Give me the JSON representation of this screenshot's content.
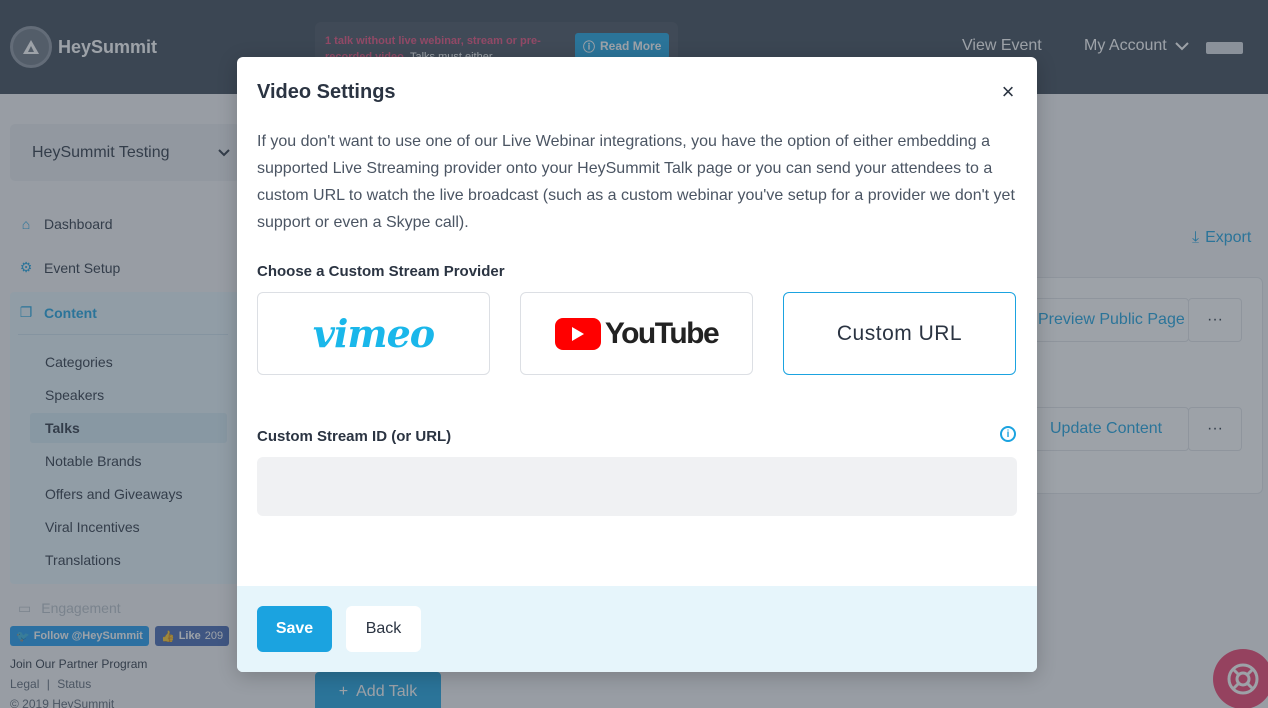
{
  "app": {
    "brand": "HeySummit",
    "notice": {
      "text_highlight": "1 talk without live webinar, stream or pre-recorded video.",
      "text_rest": "Talks must either",
      "button": "Read More"
    },
    "nav_links": {
      "view_event": "View Event",
      "my_account": "My Account"
    }
  },
  "sidebar": {
    "event_name": "HeySummit Testing",
    "items": [
      {
        "label": "Dashboard",
        "icon": "home-icon"
      },
      {
        "label": "Event Setup",
        "icon": "gears-icon"
      },
      {
        "label": "Content",
        "icon": "copy-icon"
      }
    ],
    "content_sub": [
      "Categories",
      "Speakers",
      "Talks",
      "Notable Brands",
      "Offers and Giveaways",
      "Viral Incentives",
      "Translations"
    ],
    "active_sub": "Talks",
    "faded_item": "Engagement",
    "twitter": "Follow @HeySummit",
    "fb_like": "Like",
    "fb_count": "209",
    "partner": "Join Our Partner Program",
    "legal": "Legal",
    "status": "Status",
    "copyright": "© 2019 HeySummit"
  },
  "main": {
    "export": "Export",
    "preview_public_page": "Preview Public Page",
    "update_content": "Update Content",
    "more": "···",
    "add_talk": "Add Talk"
  },
  "modal": {
    "title": "Video Settings",
    "close": "×",
    "description": "If you don't want to use one of our Live Webinar integrations, you have the option of either embedding a supported Live Streaming provider onto your HeySummit Talk page or you can send your attendees to a custom URL to watch the live broadcast (such as a custom webinar you've setup for a provider we don't yet support or even a Skype call).",
    "provider_label": "Choose a Custom Stream Provider",
    "providers": [
      {
        "name": "vimeo",
        "selected": false
      },
      {
        "name": "YouTube",
        "selected": false
      },
      {
        "name": "Custom URL",
        "selected": true
      }
    ],
    "stream_label": "Custom Stream ID (or URL)",
    "stream_value": "",
    "save": "Save",
    "back": "Back"
  },
  "colors": {
    "accent": "#1ba3e0",
    "topbar": "#3b4654",
    "help": "#ee3f6c",
    "youtube_red": "#ff0000",
    "vimeo_blue": "#1ab7ea"
  }
}
